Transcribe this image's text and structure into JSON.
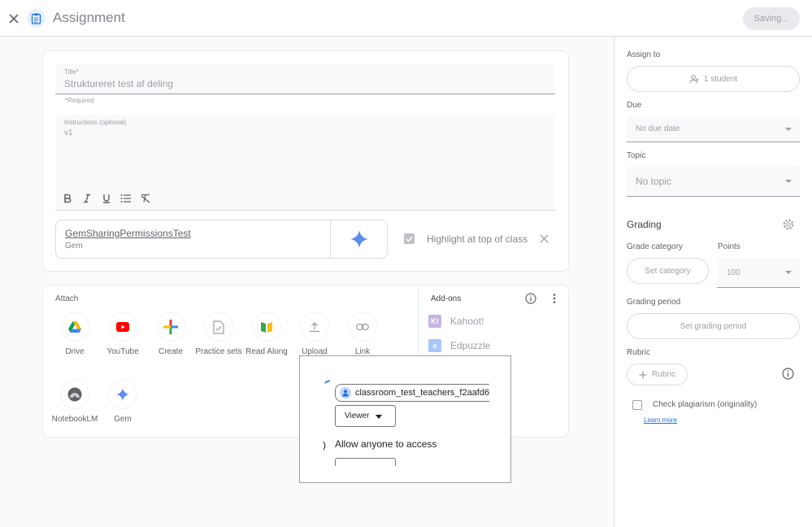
{
  "header": {
    "title": "Assignment",
    "saving_label": "Saving..."
  },
  "form": {
    "title_label": "Title*",
    "title_value": "Struktureret test af deling",
    "required_note": "*Required",
    "instructions_label": "Instructions (optional)",
    "instructions_value": "v1"
  },
  "gem_attachment": {
    "name": "GemSharingPermissionsTest",
    "type": "Gem",
    "highlight_label": "Highlight at top of class"
  },
  "attach": {
    "title": "Attach",
    "items": [
      {
        "label": "Drive",
        "icon": "drive-icon"
      },
      {
        "label": "YouTube",
        "icon": "youtube-icon"
      },
      {
        "label": "Create",
        "icon": "plus-icon"
      },
      {
        "label": "Practice sets",
        "icon": "practice-sets-icon"
      },
      {
        "label": "Read Along",
        "icon": "read-along-icon"
      },
      {
        "label": "Upload",
        "icon": "upload-icon"
      },
      {
        "label": "Link",
        "icon": "link-icon"
      },
      {
        "label": "NotebookLM",
        "icon": "notebooklm-icon"
      },
      {
        "label": "Gem",
        "icon": "gem-icon"
      }
    ]
  },
  "addons": {
    "title": "Add-ons",
    "items": [
      {
        "label": "Kahoot!",
        "icon": "kahoot-logo-icon",
        "color": "#c5b4e3"
      },
      {
        "label": "Edpuzzle",
        "icon": "edpuzzle-logo-icon",
        "color": "#a8c7fa"
      }
    ]
  },
  "share_dialog": {
    "recipient": "classroom_test_teachers_f2aafd6...",
    "role": "Viewer",
    "allow_label": "Allow anyone to access",
    "paren": ")"
  },
  "sidebar": {
    "assign_to_label": "Assign to",
    "assign_to_value": "1 student",
    "due_label": "Due",
    "due_value": "No due date",
    "topic_label": "Topic",
    "topic_value": "No topic",
    "grading_title": "Grading",
    "grade_category_label": "Grade category",
    "grade_category_button": "Set category",
    "points_label": "Points",
    "points_value": "100",
    "grading_period_label": "Grading period",
    "grading_period_button": "Set grading period",
    "rubric_label": "Rubric",
    "rubric_button": "Rubric",
    "plagiarism_label": "Check plagiarism (originality)",
    "learn_more": "Learn more"
  },
  "colors": {
    "accent": "#1a73e8",
    "youtube": "#ff0000",
    "gem_blue": "#4285f4"
  }
}
